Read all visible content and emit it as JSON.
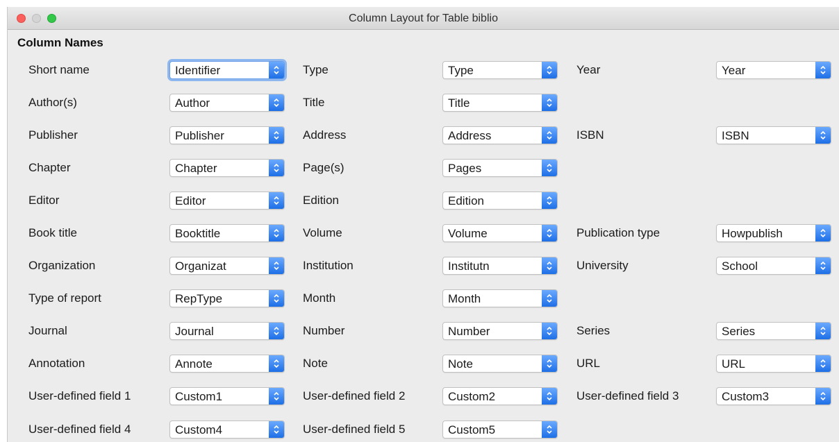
{
  "window": {
    "title": "Column Layout for Table biblio"
  },
  "section_title": "Column Names",
  "rows": [
    [
      {
        "label": "Short name",
        "value": "Identifier"
      },
      {
        "label": "Type",
        "value": "Type"
      },
      {
        "label": "Year",
        "value": "Year"
      }
    ],
    [
      {
        "label": "Author(s)",
        "value": "Author"
      },
      {
        "label": "Title",
        "value": "Title"
      },
      null
    ],
    [
      {
        "label": "Publisher",
        "value": "Publisher"
      },
      {
        "label": "Address",
        "value": "Address"
      },
      {
        "label": "ISBN",
        "value": "ISBN"
      }
    ],
    [
      {
        "label": "Chapter",
        "value": "Chapter"
      },
      {
        "label": "Page(s)",
        "value": "Pages"
      },
      null
    ],
    [
      {
        "label": "Editor",
        "value": "Editor"
      },
      {
        "label": "Edition",
        "value": "Edition"
      },
      null
    ],
    [
      {
        "label": "Book title",
        "value": "Booktitle"
      },
      {
        "label": "Volume",
        "value": "Volume"
      },
      {
        "label": "Publication type",
        "value": "Howpublish"
      }
    ],
    [
      {
        "label": "Organization",
        "value": "Organizat"
      },
      {
        "label": "Institution",
        "value": "Institutn"
      },
      {
        "label": "University",
        "value": "School"
      }
    ],
    [
      {
        "label": "Type of report",
        "value": "RepType"
      },
      {
        "label": "Month",
        "value": "Month"
      },
      null
    ],
    [
      {
        "label": "Journal",
        "value": "Journal"
      },
      {
        "label": "Number",
        "value": "Number"
      },
      {
        "label": "Series",
        "value": "Series"
      }
    ],
    [
      {
        "label": "Annotation",
        "value": "Annote"
      },
      {
        "label": "Note",
        "value": "Note"
      },
      {
        "label": "URL",
        "value": "URL"
      }
    ],
    [
      {
        "label": "User-defined field 1",
        "value": "Custom1"
      },
      {
        "label": "User-defined field 2",
        "value": "Custom2"
      },
      {
        "label": "User-defined field 3",
        "value": "Custom3"
      }
    ],
    [
      {
        "label": "User-defined field 4",
        "value": "Custom4"
      },
      {
        "label": "User-defined field 5",
        "value": "Custom5"
      },
      null
    ]
  ],
  "icons": {
    "combo_arrow": "updown-chevron-icon"
  },
  "colors": {
    "accent": "#2b7cf0",
    "focus_ring": "#8db7ee"
  }
}
